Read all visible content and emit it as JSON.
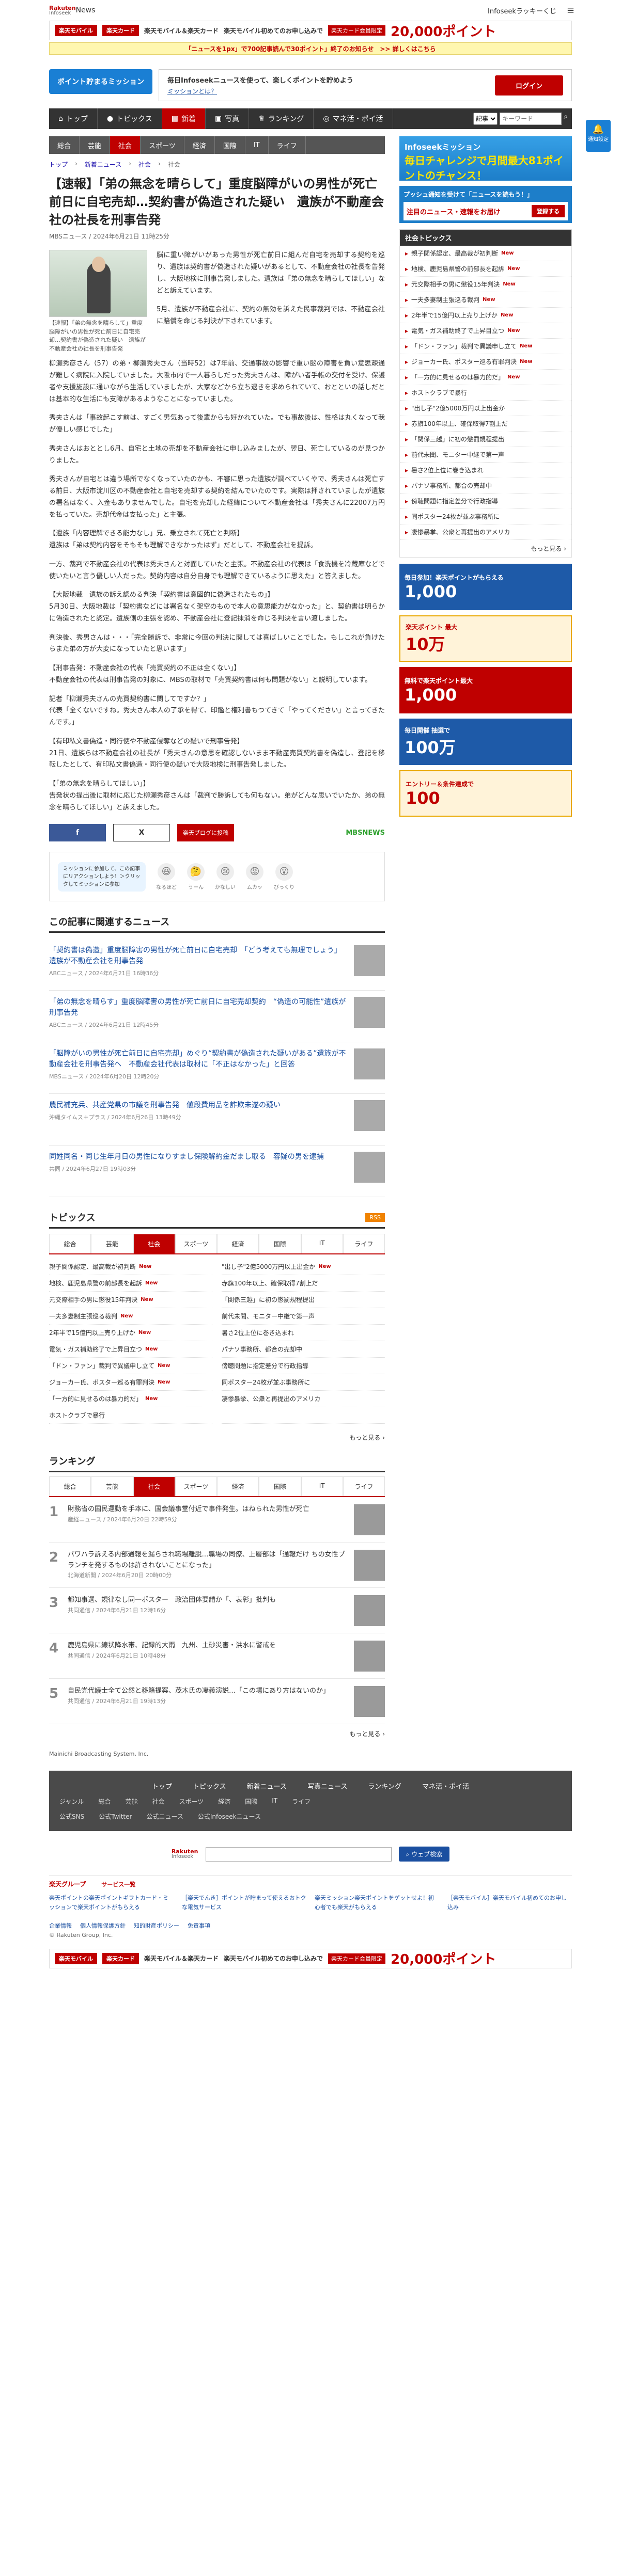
{
  "header": {
    "rakuten": "Rakuten",
    "infoseek": "Infoseek",
    "news": "News",
    "lucky": "Infoseekラッキーくじ",
    "menu": "≡"
  },
  "top_banner": {
    "pill1": "楽天モバイル",
    "pill2": "楽天カード",
    "tag": "楽天モバイル＆楽天カード",
    "text": "楽天モバイル初めてのお申し込みで",
    "sub": "楽天カード会員限定",
    "points": "20,000ポイント"
  },
  "yellow": "「ニュースを1px」で700記事読んで30ポイント」終了のお知らせ　>> 詳しくはこちら",
  "mission": {
    "button": "ポイント貯まるミッション",
    "text": "毎日Infoseekニュースを使って、楽しくポイントを貯めよう",
    "link": "ミッションとは？",
    "login": "ログイン"
  },
  "nav": {
    "items": [
      "トップ",
      "トピックス",
      "新着",
      "写真",
      "ランキング",
      "マネ活・ポイ活"
    ],
    "select": "記事",
    "placeholder": "キーワード"
  },
  "side_button": "通知設定",
  "subnav": [
    "総合",
    "芸能",
    "社会",
    "スポーツ",
    "経済",
    "国際",
    "IT",
    "ライフ"
  ],
  "breadcrumb": [
    "トップ",
    "新着ニュース",
    "社会",
    "社会"
  ],
  "article": {
    "title": "【速報】「弟の無念を晴らして」重度脳障がいの男性が死亡前日に自宅売却…契約書が偽造された疑い　遺族が不動産会社の社長を刑事告発",
    "meta": "MBSニュース / 2024年6月21日 11時25分",
    "caption": "【速報】「弟の無念を晴らして」重度脳障がいの男性が死亡前日に自宅売却…契約書が偽造された疑い　遺族が不動産会社の社長を刑事告発",
    "paragraphs": [
      "脳に重い障がいがあった男性が死亡前日に組んだ自宅を売却する契約を巡り、遺族は契約書が偽造された疑いがあるとして、不動産会社の社長を告発し、大阪地検に刑事告発しました。遺族は「弟の無念を晴らしてほしい」などと訴えています。",
      "5月、遺族が不動産会社に、契約の無効を訴えた民事裁判では、不動産会社に賠償を命じる判決が下されています。",
      "柳瀬秀彦さん（57）の弟・柳瀬秀夫さん（当時52）は7年前、交通事故の影響で重い脳の障害を負い意思疎通が難しく病院に入院していました。大阪市内で一人暮らしだった秀夫さんは、障がい者手帳の交付を受け、保護者や支援施設に通いながら生活していましたが、大家などから立ち退きを求められていて、おとといの話しだとは基本的な生活にも支障があるようなことになっていました。",
      "秀夫さんは「事故起こす前は、すごく男気あって後輩からも好かれていた。でも事故後は、性格は丸くなって我が優しい感じでした」",
      "秀夫さんはおととし6月、自宅と土地の売却を不動産会社に申し込みましたが、翌日、死亡しているのが見つかりました。",
      "秀夫さんが自宅とは違う場所でなくなっていたのかも、不審に思った遺族が調べていくやで、秀夫さんは死亡する前日、大阪市淀川区の不動産会社と自宅を売却する契約を結んでいたのです。実際は押されていましたが遺族の署名はなく、入金もありませんでした。自宅を売却した経緯について不動産会社は「秀夫さんに22007万円を払っていた。売却代金は支払った」と主張。",
      "【遺族「内容理解できる能力なし」兄、乗立されて死亡と判断】\n遺族は「弟は契約内容をそもそも理解できなかったはず」だとして、不動産会社を提訴。",
      "一方、裁判で不動産会社の代表は秀夫さんと対面していたと主張。不動産会社の代表は「食洗機を冷蔵庫などで使いたいと言う優しい人だった。契約内容は自分自身でも理解できているように思えた」と答えました。",
      "【大阪地裁　遺族の訴え認める判決「契約書は意図的に偽造されたもの」】\n5月30日、大阪地裁は「契約書などには署名なく架空のもので本人の意思能力がなかった」と、契約書は明らかに偽造されたと認定。遺族側の主張を認め、不動産会社に登記抹消を命じる判決を言い渡しました。",
      "判決後、秀男さんは・・・「完全勝訴で、非常に今回の判決に関しては喜ばしいことでした。もしこれが負けたらまた弟の方が大変になっていたと思います」",
      "【刑事告発：不動産会社の代表「売買契約の不正は全くない」】\n不動産会社の代表は刑事告発の対象に、MBSの取材で「売買契約書は何も問題がない」と説明しています。",
      "記者「柳瀬秀夫さんの売買契約書に関してですか？」\n代表「全くないですね。秀夫さん本人の了承を得て、印鑑と権利書もつてきて「やってください」と言ってきたんです。」",
      "【有印私文書偽造・同行使や不動産侵奪などの疑いで刑事告発】\n21日、遺族らは不動産会社の社長が「秀夫さんの意思を確認しないまま不動産売買契約書を偽造し、登記を移転したとして、有印私文書偽造・同行使の疑いで大阪地検に刑事告発しました。",
      "【「弟の無念を晴らしてほしい」】\n告発状の提出後に取材に応じた柳瀬秀彦さんは「裁判で勝訴しても何もない。弟がどんな思いでいたか、弟の無念を晴らしてほしい」と訴えました。"
    ]
  },
  "share": {
    "fb": "f",
    "x": "X",
    "rk": "楽天ブログに投稿",
    "source": "MBSNEWS"
  },
  "react": {
    "bubble": "ミッションに参加して、この記事にリアクションしよう！＞クリックしてミッションに参加",
    "items": [
      {
        "e": "😆",
        "l": "なるほど"
      },
      {
        "e": "🤔",
        "l": "うーん"
      },
      {
        "e": "😢",
        "l": "かなしい"
      },
      {
        "e": "😡",
        "l": "ムカッ"
      },
      {
        "e": "😮",
        "l": "びっくり"
      }
    ]
  },
  "related": {
    "title": "この記事に関連するニュース",
    "items": [
      {
        "t": "「契約書は偽造」重度脳障害の男性が死亡前日に自宅売却　「どう考えても無理でしょう」遺族が不動産会社を刑事告発",
        "m": "ABCニュース / 2024年6月21日 16時36分"
      },
      {
        "t": "「弟の無念を晴らす」重度脳障害の男性が死亡前日に自宅売却契約　“偽造の可能性”遺族が刑事告発",
        "m": "ABCニュース / 2024年6月21日 12時45分"
      },
      {
        "t": "「脳障がいの男性が死亡前日に自宅売却」めぐり“契約書が偽造された疑いがある”遺族が不動産会社を刑事告発へ　不動産会社代表は取材に「不正はなかった」と回答",
        "m": "MBSニュース / 2024年6月20日 12時20分"
      },
      {
        "t": "農民補充兵、共産党県の市議を刑事告発　値段費用品を詐欺未遂の疑い",
        "m": "沖縄タイムス＋プラス / 2024年6月26日 13時49分"
      },
      {
        "t": "同姓同名・同じ生年月日の男性になりすまし保険解約金だまし取る　容疑の男を逮捕",
        "m": "共同 / 2024年6月27日 19時03分"
      }
    ]
  },
  "topics": {
    "title": "トピックス",
    "rss": "RSS",
    "tabs": [
      "総合",
      "芸能",
      "社会",
      "スポーツ",
      "経済",
      "国際",
      "IT",
      "ライフ"
    ],
    "left": [
      "親子関係認定、最高裁が初判断",
      "地検、鹿児島県警の前部長を起訴",
      "元交際相手の男に懲役15年判決",
      "一夫多妻制主張巡る裁判",
      "2年半で15億円以上売り上げか",
      "電気・ガス補助終了で上昇目立つ",
      "「ドン・ファン」裁判で異議申し立て",
      "ジョーカー氏、ポスター巡る有罪判決",
      "「一方的に見せるのは暴力的だ」",
      "ホストクラブで暴行"
    ],
    "right": [
      "\"出し子\"2億5000万円以上出金か",
      "赤旗100年以上、確保取得7割上だ",
      "「関係三越」に初の懲罰規程提出",
      "前代未聞、モニター中継で第一声",
      "暑さ2位上位に巻き込まれ",
      "パナソ事務所、都合の売却中",
      "傍聴問題に指定差分で行政指導",
      "同ポスター24枚が並ぶ事務所に",
      "凄惨暴挙、公衆と再提出のアメリカ",
      ""
    ]
  },
  "topics_more": "もっと見る",
  "ranking": {
    "title": "ランキング",
    "tabs": [
      "総合",
      "芸能",
      "社会",
      "スポーツ",
      "経済",
      "国際",
      "IT",
      "ライフ"
    ],
    "items": [
      {
        "n": "1",
        "t": "財務省の国民運動を手本に、国会議事堂付近で事件発生。はねられた男性が死亡",
        "m": "産経ニュース / 2024年6月20日 22時59分"
      },
      {
        "n": "2",
        "t": "パワハラ訴える内部通報を漏らされ職場離脱…職場の同僚、上層部は「通報だけ ちの女性ブランチを発するものは許されないことになった」",
        "m": "北海道新聞 / 2024年6月20日 20時00分"
      },
      {
        "n": "3",
        "t": "都知事選、規律なし同一ポスター　政治団体要請か「、表彰」批判も",
        "m": "共同通信 / 2024年6月21日 12時16分"
      },
      {
        "n": "4",
        "t": "鹿児島県に線状降水帯、記録的大雨　九州、土砂災害・洪水に警戒を",
        "m": "共同通信 / 2024年6月21日 10時48分"
      },
      {
        "n": "5",
        "t": "自民党代議士全て公然と移籍提案、茂木氏の凄義演説…「この場にあり方はないのか」",
        "m": "共同通信 / 2024年6月21日 19時13分"
      }
    ]
  },
  "ranking_more": "もっと見る",
  "copyright_mbs": "Mainichi Broadcasting System, Inc.",
  "sidebar": {
    "ad_blue_a": "Infoseekミッション",
    "ad_blue_b": "毎日チャレンジで月間最大81ポイントのチャンス！",
    "push_head": "プッシュ通知を受けて「ニュースを読もう！」",
    "push_in": "注目のニュース・速報をお届け",
    "push_btn": "登録する",
    "topics_head": "社会トピックス",
    "topics": [
      "親子関係認定、最高裁が初判断",
      "地検、鹿児島県警の前部長を起訴",
      "元交際相手の男に懲役15年判決",
      "一夫多妻制主張巡る裁判",
      "2年半で15億円以上売り上げか",
      "電気・ガス補助終了で上昇目立つ",
      "「ドン・ファン」裁判で異議申し立て",
      "ジョーカー氏、ポスター巡る有罪判決",
      "「一方的に見せるのは暴力的だ」",
      "ホストクラブで暴行",
      "\"出し子\"2億5000万円以上出金か",
      "赤旗100年以上、確保取得7割上だ",
      "「関係三越」に初の懲罰規程提出",
      "前代未聞、モニター中継で第一声",
      "暑さ2位上位に巻き込まれ",
      "パナソ事務所、都合の売却中",
      "傍聴問題に指定差分で行政指導",
      "同ポスター24枚が並ぶ事務所に",
      "凄惨暴挙、公衆と再提出のアメリカ"
    ],
    "more": "もっと見る",
    "promos": [
      {
        "s": "毎日参加！楽天ポイントがもらえる",
        "b": "1,000"
      },
      {
        "s": "楽天ポイント 最大",
        "b": "10万"
      },
      {
        "s": "無料で楽天ポイント最大",
        "b": "1,000"
      },
      {
        "s": "毎日開催 抽選で",
        "b": "100万"
      },
      {
        "s": "エントリー＆条件達成で",
        "b": "100"
      }
    ]
  },
  "footer": {
    "row1": [
      "トップ",
      "トピックス",
      "新着ニュース",
      "写真ニュース",
      "ランキング",
      "マネ活・ポイ活"
    ],
    "row2": [
      "ジャンル",
      "総合",
      "芸能",
      "社会",
      "スポーツ",
      "経済",
      "国際",
      "IT",
      "ライフ"
    ],
    "row3": [
      "公式SNS",
      "公式Twitter",
      "公式ニュース",
      "公式Infoseekニュース"
    ],
    "search_btn": "ウェブ検索",
    "group_title": "楽天グループ",
    "group_sub": "サービス一覧",
    "group_cols": [
      "楽天ポイントの楽天ポイントギフトカード・ミッションで楽天ポイントがもらえる",
      "［楽天でんき］ポイントが貯まって使えるおトクな電気サービス",
      "楽天ミッション楽天ポイントをゲットせよ！初心者でも楽天がもらえる",
      "［楽天モバイル］楽天モバイル初めてのお申し込み"
    ],
    "links": [
      "企業情報",
      "個人情報保護方針",
      "知的財産ポリシー",
      "免責事項"
    ],
    "copyright": "© Rakuten Group, Inc."
  }
}
